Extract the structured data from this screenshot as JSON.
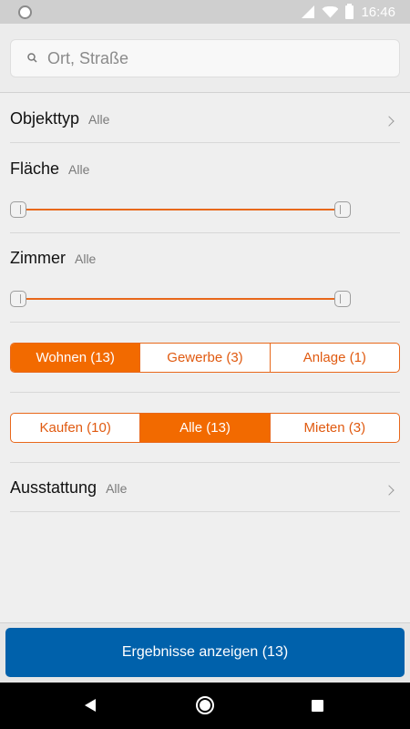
{
  "status_bar": {
    "time": "16:46"
  },
  "search": {
    "placeholder": "Ort, Straße"
  },
  "objekttyp": {
    "title": "Objekttyp",
    "value": "Alle"
  },
  "flaeche": {
    "title": "Fläche",
    "value": "Alle",
    "slider_min_fraction": 0.0,
    "slider_max_fraction": 1.0
  },
  "zimmer": {
    "title": "Zimmer",
    "value": "Alle",
    "slider_min_fraction": 0.0,
    "slider_max_fraction": 1.0
  },
  "category_segment": {
    "options": [
      "Wohnen (13)",
      "Gewerbe (3)",
      "Anlage (1)"
    ],
    "selected": "Wohnen (13)"
  },
  "type_segment": {
    "options": [
      "Kaufen (10)",
      "Alle (13)",
      "Mieten (3)"
    ],
    "selected": "Alle (13)"
  },
  "ausstattung": {
    "title": "Ausstattung",
    "value": "Alle"
  },
  "cta": {
    "label": "Ergebnisse anzeigen (13)"
  },
  "colors": {
    "accent": "#f26a00",
    "primary_button": "#0061ab"
  }
}
